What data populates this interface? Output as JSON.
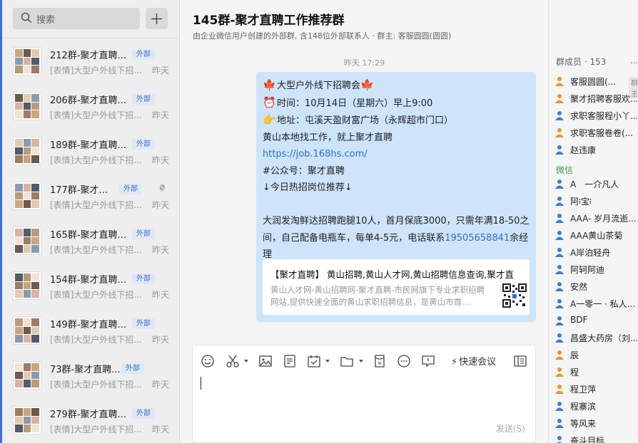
{
  "sidebar": {
    "search_placeholder": "搜索",
    "chats": [
      {
        "name": "212群-聚才直聘...",
        "tag": "外部",
        "preview": "[表情]大型户外线下招...",
        "time": "昨天",
        "muted": false
      },
      {
        "name": "206群-聚才直聘...",
        "tag": "外部",
        "preview": "[表情]大型户外线下招...",
        "time": "昨天",
        "muted": false
      },
      {
        "name": "189群-聚才直聘...",
        "tag": "外部",
        "preview": "[表情]大型户外线下招...",
        "time": "昨天",
        "muted": false
      },
      {
        "name": "177群-聚才...",
        "tag": "外部",
        "preview": "[表情]大型户外线下招...",
        "time": "昨天",
        "muted": true
      },
      {
        "name": "165群-聚才直聘...",
        "tag": "外部",
        "preview": "[表情]大型户外线下招...",
        "time": "昨天",
        "muted": false
      },
      {
        "name": "154群-聚才直聘...",
        "tag": "外部",
        "preview": "[表情]大型户外线下招...",
        "time": "昨天",
        "muted": false
      },
      {
        "name": "149群-聚才直聘...",
        "tag": "外部",
        "preview": "[表情]大型户外线下招...",
        "time": "昨天",
        "muted": false
      },
      {
        "name": "73群-聚才直聘...",
        "tag": "外部",
        "preview": "[表情]大型户外线下招...",
        "time": "昨天",
        "muted": false
      },
      {
        "name": "279群-聚才直聘...",
        "tag": "外部",
        "preview": "[表情]大型户外线下招...",
        "time": "昨天",
        "muted": false
      }
    ]
  },
  "chat": {
    "title": "145群-聚才直聘工作推荐群",
    "subtitle": "由企业微信用户创建的外部群, 含148位外部联系人 · 群主: 客服圆圆(圆圆)",
    "timestamp": "昨天 17:29",
    "message": {
      "line1": "大型户外线下招聘会",
      "line2": "时间：10月14日（星期六）早上9:00",
      "line3": "地址：屯溪天盈财富广场（永辉超市门口）",
      "line4": "黄山本地找工作，就上聚才直聘",
      "link": "https://job.168hs.com/",
      "line6": "#公众号：聚才直聘",
      "line7": "↓今日热招岗位推荐↓",
      "para_before_phone": "大润发淘鲜达招聘跑腿10人，首月保底3000，只需年满18-50之间，自己配备电瓶车，每单4-5元，电话联系",
      "phone": "19505658841",
      "para_after_phone": "余经理",
      "card_title": "【聚才直聘】 黄山招聘,黄山人才网,黄山招聘信息查询,聚才直",
      "card_desc": "黄山人才网-黄山招聘网-聚才直聘-市民网旗下专业求职招聘网站,提供快速全面的黄山求职招聘信息，是黄山市首..."
    },
    "meeting_label": "快速会议",
    "send_label": "发送(S)"
  },
  "members": {
    "header": "群成员 · 153",
    "more": "...",
    "owner_badge": "群主",
    "wechat_label": "微信",
    "staff": [
      {
        "name": "客服圆圆(...",
        "color": "#f0902a"
      },
      {
        "name": "聚才招聘客服欢...",
        "color": "#f0902a"
      },
      {
        "name": "求职客服程小丫...",
        "color": "#3d7bd8"
      },
      {
        "name": "求职客服卷卷(...",
        "color": "#f0902a"
      },
      {
        "name": "赵违康",
        "color": "#3d7bd8"
      }
    ],
    "wechat": [
      {
        "name": "A　一介凡人",
        "color": "#3d7bd8"
      },
      {
        "name": "阿፧宝፧",
        "color": "#3d7bd8"
      },
      {
        "name": "AAA- 岁月流逝...",
        "color": "#3d7bd8"
      },
      {
        "name": "AAA黄山茶菊",
        "color": "#3d7bd8"
      },
      {
        "name": "A岸泊轻舟",
        "color": "#3d7bd8"
      },
      {
        "name": "阿轲阿迪",
        "color": "#3d7bd8"
      },
      {
        "name": "安然",
        "color": "#3d7bd8"
      },
      {
        "name": "A一零一 · 私人...",
        "color": "#3d7bd8"
      },
      {
        "name": "BDF",
        "color": "#3d7bd8"
      },
      {
        "name": "昌盛大药房（刘...",
        "color": "#3d7bd8"
      },
      {
        "name": "辰",
        "color": "#f0902a"
      },
      {
        "name": "程",
        "color": "#f0902a"
      },
      {
        "name": "程卫萍",
        "color": "#f0902a"
      },
      {
        "name": "程寨滨",
        "color": "#3d7bd8"
      },
      {
        "name": "等风来",
        "color": "#3d7bd8"
      },
      {
        "name": "奋斗目标",
        "color": "#3d7bd8"
      }
    ]
  }
}
